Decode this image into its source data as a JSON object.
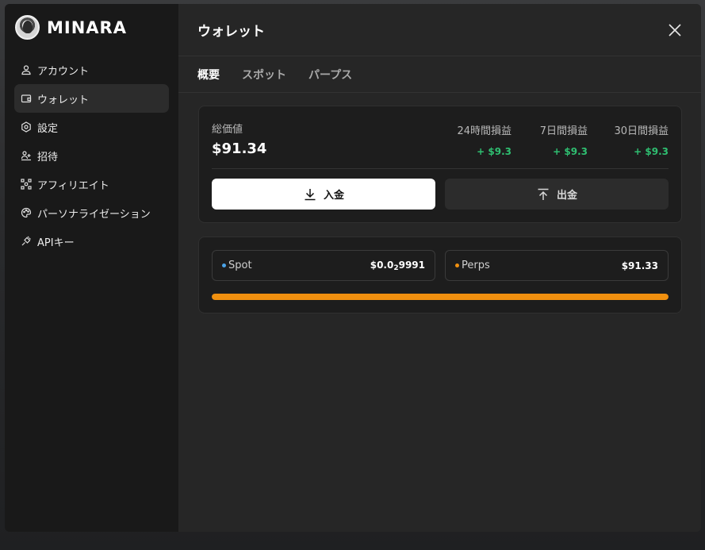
{
  "brand": {
    "name": "MINARA"
  },
  "sidebar": {
    "items": [
      {
        "label": "アカウント",
        "icon": "user-icon",
        "active": false
      },
      {
        "label": "ウォレット",
        "icon": "wallet-icon",
        "active": true
      },
      {
        "label": "設定",
        "icon": "settings-icon",
        "active": false
      },
      {
        "label": "招待",
        "icon": "invite-icon",
        "active": false
      },
      {
        "label": "アフィリエイト",
        "icon": "affiliate-icon",
        "active": false
      },
      {
        "label": "パーソナライゼーション",
        "icon": "palette-icon",
        "active": false
      },
      {
        "label": "APIキー",
        "icon": "plug-icon",
        "active": false
      }
    ]
  },
  "header": {
    "title": "ウォレット"
  },
  "tabs": [
    {
      "label": "概要",
      "active": true
    },
    {
      "label": "スポット",
      "active": false
    },
    {
      "label": "パープス",
      "active": false
    }
  ],
  "summary": {
    "total_label": "総価値",
    "total_value": "$91.34",
    "pnl": [
      {
        "label": "24時間損益",
        "value": "+ $9.3"
      },
      {
        "label": "7日間損益",
        "value": "+ $9.3"
      },
      {
        "label": "30日間損益",
        "value": "+ $9.3"
      }
    ],
    "deposit_label": "入金",
    "withdraw_label": "出金"
  },
  "balances": {
    "spot": {
      "name": "Spot",
      "value_prefix": "$0.0",
      "value_sub": "2",
      "value_suffix": "9991",
      "color": "#4aa3e8"
    },
    "perps": {
      "name": "Perps",
      "value": "$91.33",
      "color": "#f0900f"
    },
    "allocation_perps_fraction": 1.0,
    "bar_color": "#f0900f"
  },
  "colors": {
    "positive": "#2fbf71",
    "accent": "#f0900f"
  }
}
